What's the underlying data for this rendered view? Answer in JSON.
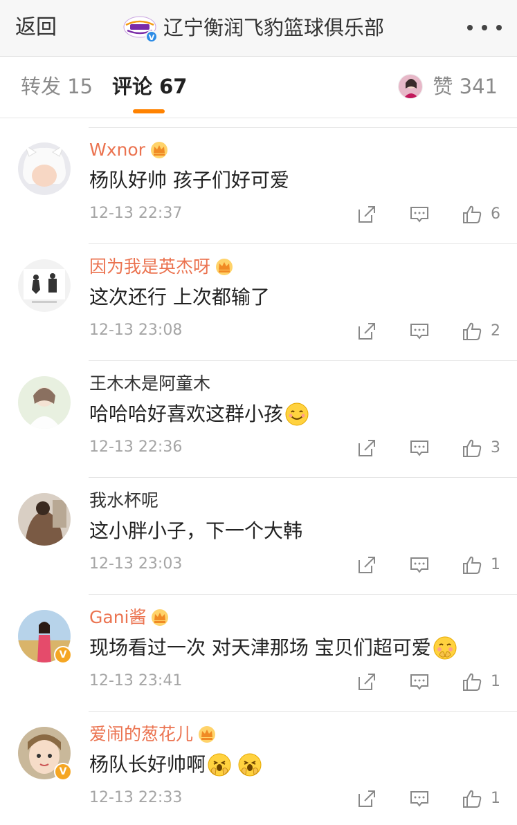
{
  "nav": {
    "back_label": "返回",
    "title": "辽宁衡润飞豹篮球俱乐部",
    "verified_mark": "V",
    "more_icon": "more-dots-icon"
  },
  "tabs": {
    "repost": "转发 15",
    "comment": "评论 67",
    "like": "赞 341",
    "accent_color": "#ff8200"
  },
  "colors": {
    "vip_name": "#eb7350",
    "time": "#a5a5a5",
    "verified_orange": "#f5a623",
    "verified_blue": "#2e8ce6"
  },
  "comments": [
    {
      "user": "Wxnor",
      "vip": true,
      "verified": false,
      "text": "杨队好帅 孩子们好可爱",
      "time": "12-13 22:37",
      "likes": "6"
    },
    {
      "user": "因为我是英杰呀",
      "vip": true,
      "verified": false,
      "text": "这次还行 上次都输了",
      "time": "12-13 23:08",
      "likes": "2"
    },
    {
      "user": "王木木是阿童木",
      "vip": false,
      "verified": false,
      "text": "哈哈哈好喜欢这群小孩",
      "emoji": "smile-emoji",
      "time": "12-13 22:36",
      "likes": "3"
    },
    {
      "user": "我水杯呢",
      "vip": false,
      "verified": false,
      "text": "这小胖小子，下一个大韩",
      "time": "12-13 23:03",
      "likes": "1"
    },
    {
      "user": "Gani酱",
      "vip": true,
      "verified": true,
      "text": "现场看过一次 对天津那场 宝贝们超可爱",
      "emoji": "shy-emoji",
      "time": "12-13 23:41",
      "likes": "1"
    },
    {
      "user": "爱闹的葱花儿",
      "vip": true,
      "verified": true,
      "text": "杨队长好帅啊",
      "emoji": "adore-emoji",
      "emoji_count": 2,
      "time": "12-13 22:33",
      "likes": "1"
    }
  ]
}
